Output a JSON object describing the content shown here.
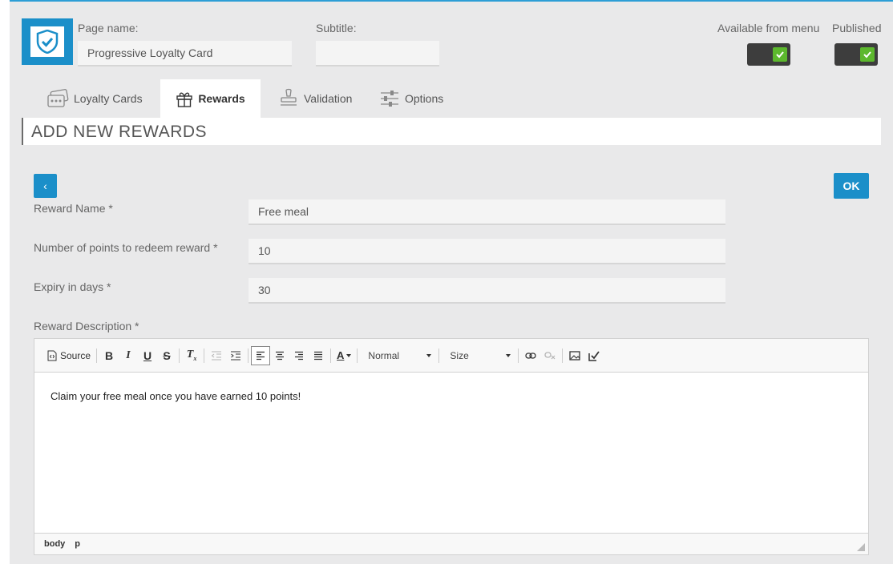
{
  "header": {
    "page_name_label": "Page name:",
    "page_name_value": "Progressive Loyalty Card",
    "subtitle_label": "Subtitle:",
    "subtitle_value": "",
    "available_label": "Available from menu",
    "published_label": "Published",
    "available_checked": true,
    "published_checked": true
  },
  "tabs": [
    {
      "label": "Loyalty Cards",
      "icon": "loyalty-cards-icon",
      "active": false
    },
    {
      "label": "Rewards",
      "icon": "gift-icon",
      "active": true
    },
    {
      "label": "Validation",
      "icon": "stamp-icon",
      "active": false
    },
    {
      "label": "Options",
      "icon": "sliders-icon",
      "active": false
    }
  ],
  "section": {
    "title": "ADD NEW REWARDS"
  },
  "buttons": {
    "back": "‹",
    "ok": "OK"
  },
  "form": {
    "reward_name_label": "Reward Name *",
    "reward_name_value": "Free meal",
    "points_label": "Number of points to redeem reward *",
    "points_value": "10",
    "expiry_label": "Expiry in days *",
    "expiry_value": "30",
    "description_label": "Reward Description *"
  },
  "editor": {
    "source_label": "Source",
    "format_value": "Normal",
    "size_value": "Size",
    "content": "Claim your free meal once you have earned 10 points!",
    "status_path": [
      "body",
      "p"
    ]
  },
  "colors": {
    "accent": "#1b8fc9",
    "toggle_on": "#5cb82d",
    "background": "#e9e9ea"
  }
}
